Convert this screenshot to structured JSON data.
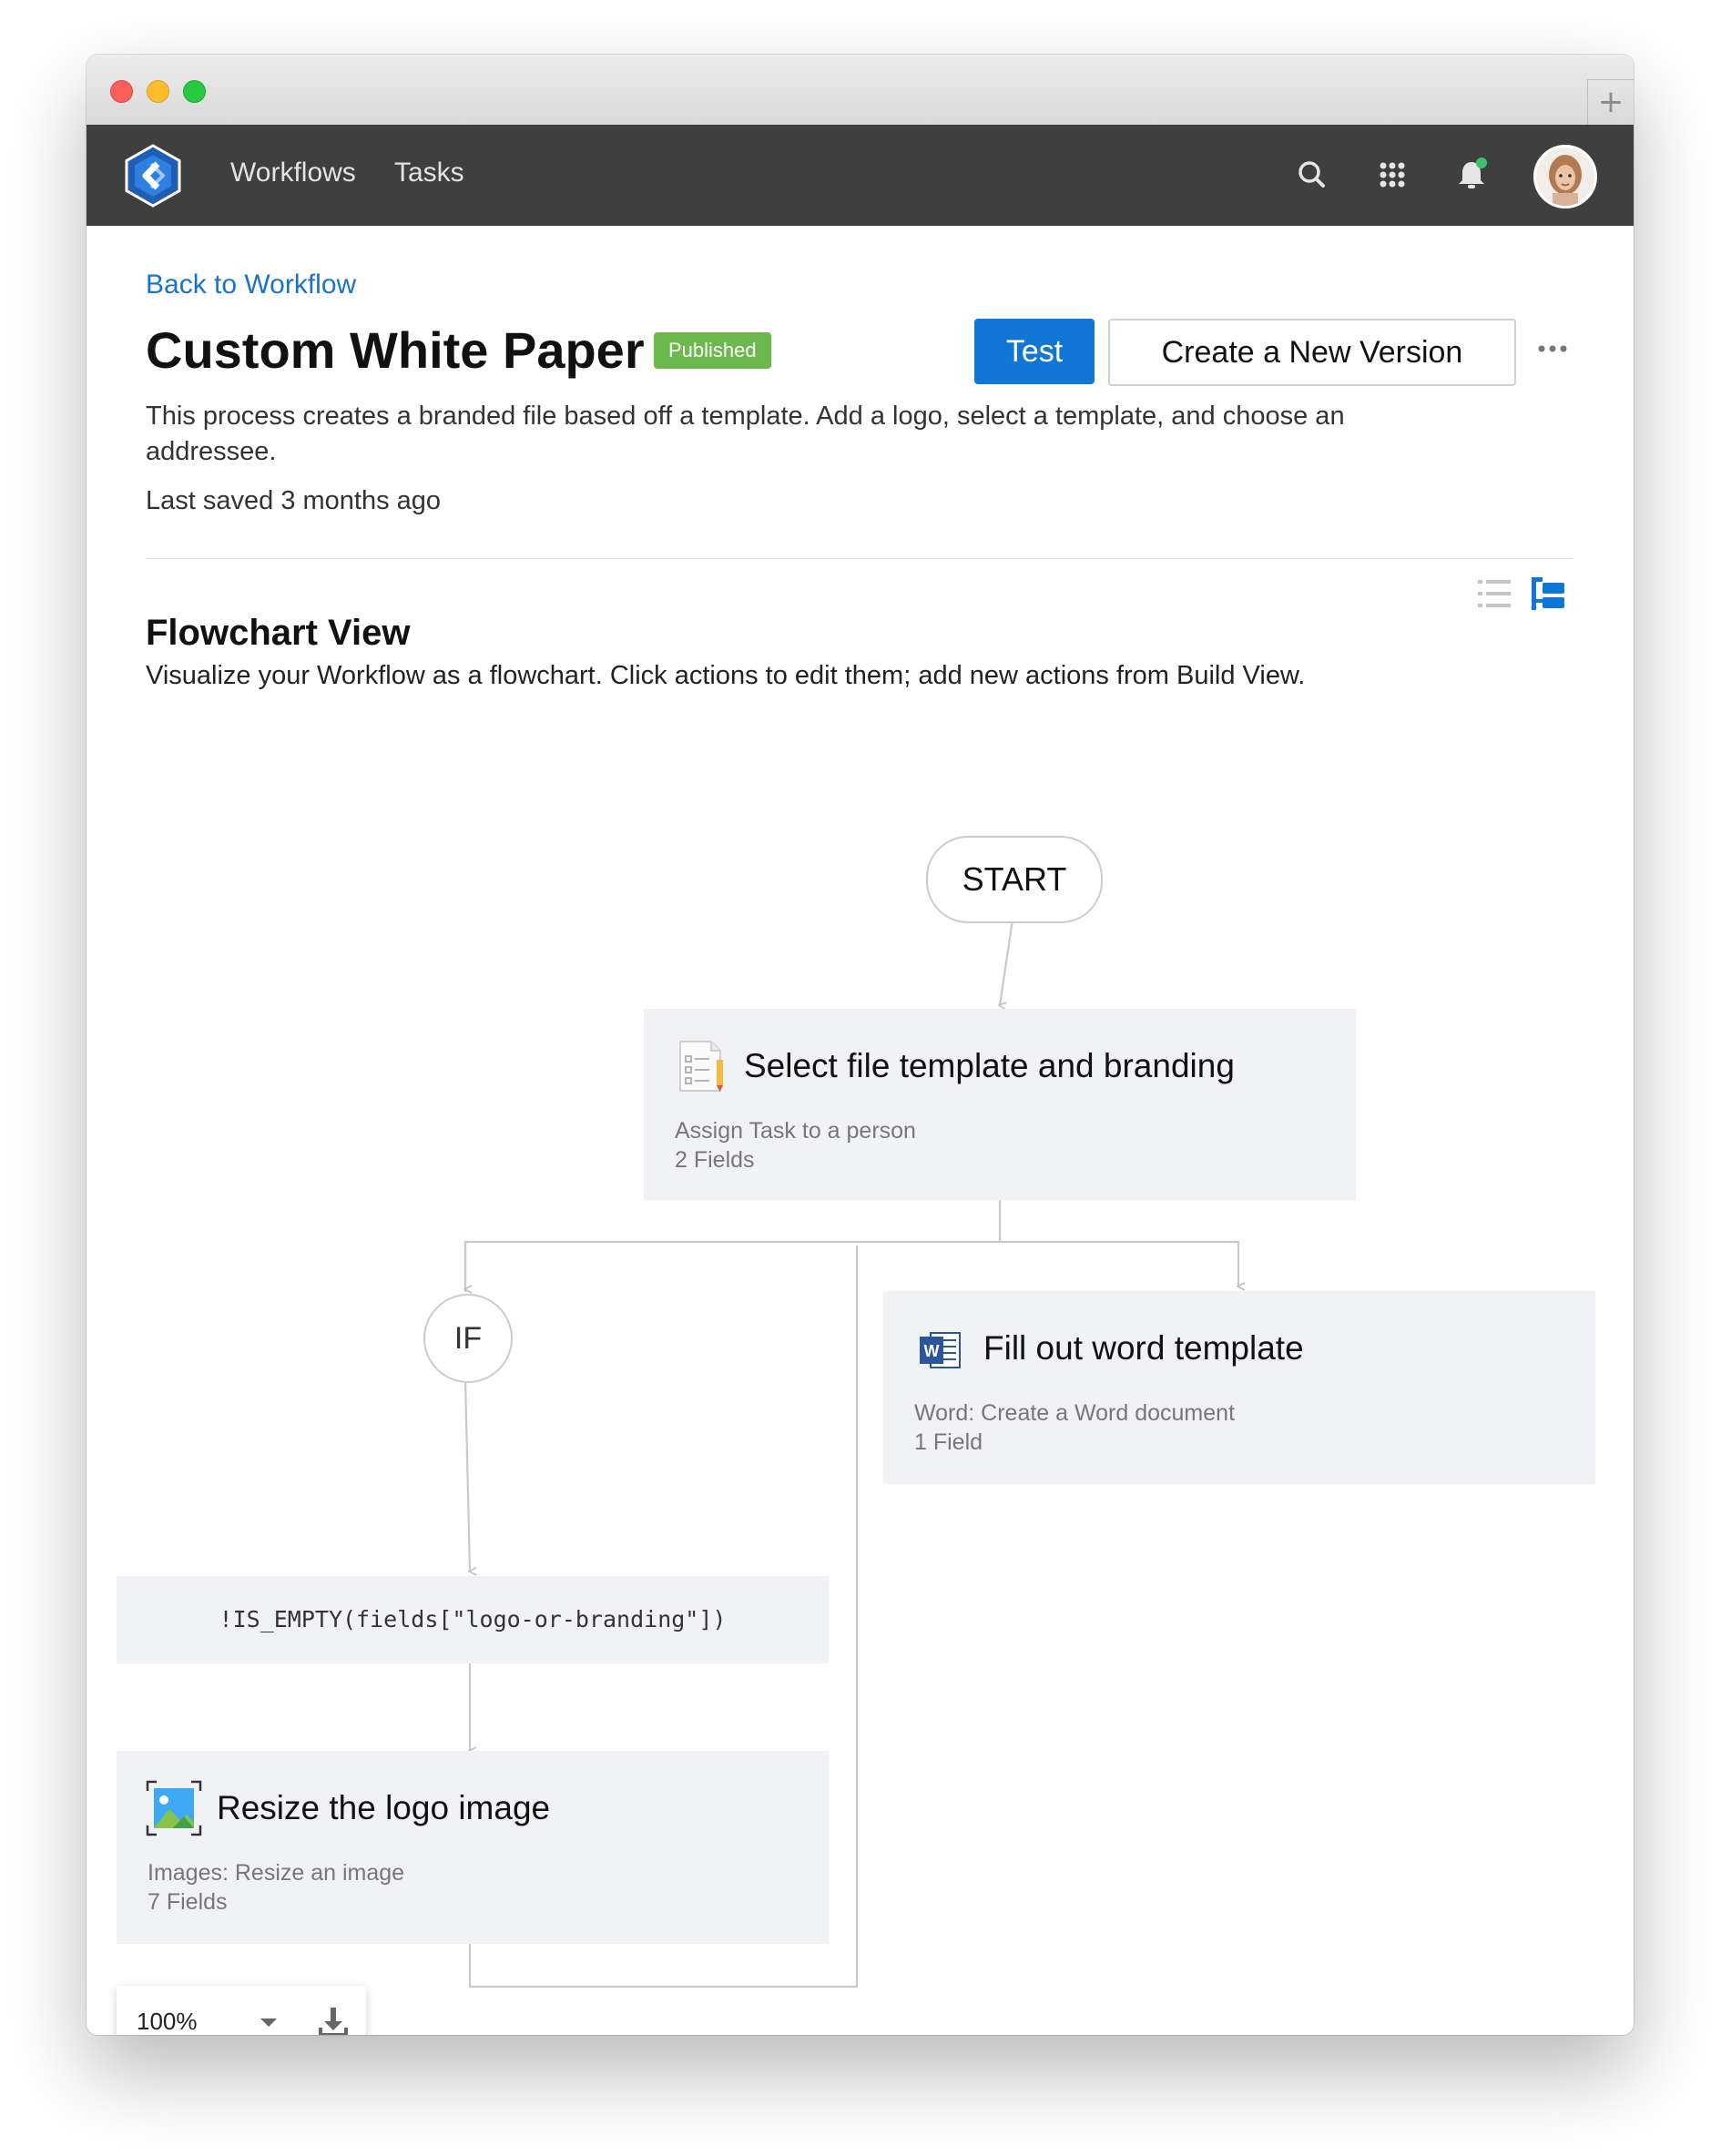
{
  "nav": {
    "links": [
      "Workflows",
      "Tasks"
    ]
  },
  "page": {
    "back_link": "Back to Workflow",
    "title": "Custom White Paper",
    "status_badge": "Published",
    "test_button": "Test",
    "new_version_button": "Create a New Version",
    "description": "This process creates a branded file based off a template. Add a logo, select a template, and choose an addressee.",
    "last_saved": "Last saved 3 months ago"
  },
  "flowchart": {
    "title": "Flowchart View",
    "subtitle": "Visualize your Workflow as a flowchart. Click actions to edit them; add new actions from Build View.",
    "start_label": "START",
    "if_label": "IF",
    "condition": "!IS_EMPTY(fields[\"logo-or-branding\"])",
    "cards": [
      {
        "title": "Select file template and branding",
        "type": "Assign Task to a person",
        "fields": "2 Fields",
        "icon": "task-form-icon"
      },
      {
        "title": "Fill out word template",
        "type": "Word: Create a Word document",
        "fields": "1 Field",
        "icon": "word-icon"
      },
      {
        "title": "Resize the logo image",
        "type": "Images: Resize an image",
        "fields": "7 Fields",
        "icon": "image-resize-icon"
      }
    ],
    "zoom": "100%"
  },
  "colors": {
    "navbar": "#3f3f3f",
    "primary": "#1176d3",
    "badge": "#6cb84d",
    "card": "#f1f2f5",
    "link": "#1a73c7"
  }
}
